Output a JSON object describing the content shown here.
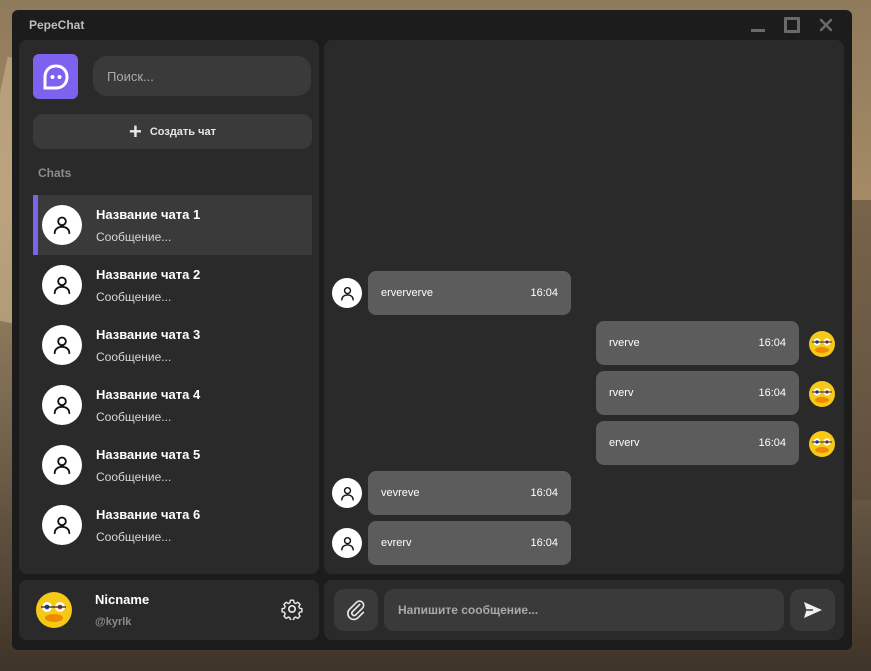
{
  "window": {
    "title": "PepeChat"
  },
  "sidebar": {
    "search_placeholder": "Поиск...",
    "create_chat_label": "Создать чат",
    "chats_label": "Chats",
    "chats": [
      {
        "name": "Название чата 1",
        "preview": "Сообщение...",
        "active": true
      },
      {
        "name": "Название чата 2",
        "preview": "Сообщение...",
        "active": false
      },
      {
        "name": "Название чата 3",
        "preview": "Сообщение...",
        "active": false
      },
      {
        "name": "Название чата 4",
        "preview": "Сообщение...",
        "active": false
      },
      {
        "name": "Название чата 5",
        "preview": "Сообщение...",
        "active": false
      },
      {
        "name": "Название чата 6",
        "preview": "Сообщение...",
        "active": false
      }
    ]
  },
  "profile": {
    "nickname": "Nicname",
    "handle": "@kyrlk"
  },
  "messages": [
    {
      "direction": "in",
      "text": "erververve",
      "time": "16:04"
    },
    {
      "direction": "out",
      "text": "rverve",
      "time": "16:04"
    },
    {
      "direction": "out",
      "text": "rverv",
      "time": "16:04"
    },
    {
      "direction": "out",
      "text": "erverv",
      "time": "16:04"
    },
    {
      "direction": "in",
      "text": "vevreve",
      "time": "16:04"
    },
    {
      "direction": "in",
      "text": "evrerv",
      "time": "16:04"
    }
  ],
  "composer": {
    "placeholder": "Напишите сообщение..."
  },
  "colors": {
    "accent": "#7d62f0",
    "panel": "#2a2a2a",
    "bubble": "#5c5c5c",
    "window": "#1c1c1c"
  }
}
